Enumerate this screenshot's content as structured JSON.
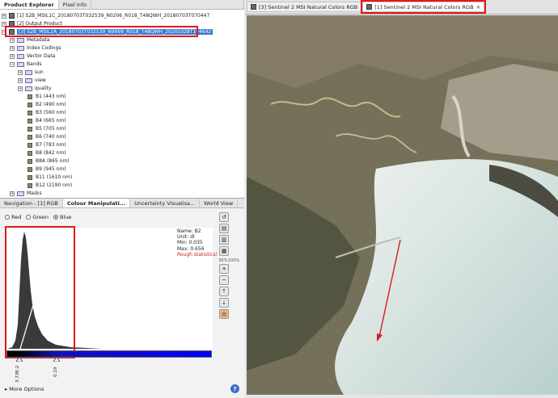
{
  "left_tabs": [
    "Product Explorer",
    "Pixel Info"
  ],
  "tree": {
    "product1": "[1] S2B_MSIL1C_20180703T032539_N0206_R018_T48QWH_20180703T070447",
    "output_product": "[2] Output Product",
    "product3": "[3] S2B_MSIL2A_20180703T032539_N9999_R018_T48QWH_20201028T194642",
    "metadata": "Metadata",
    "index_codings": "Index Codings",
    "vector_data": "Vector Data",
    "bands": "Bands",
    "folders": [
      "sun",
      "view",
      "quality"
    ],
    "band_items": [
      "B1 (443 nm)",
      "B2 (490 nm)",
      "B3 (560 nm)",
      "B4 (665 nm)",
      "B5 (705 nm)",
      "B6 (740 nm)",
      "B7 (783 nm)",
      "B8 (842 nm)",
      "B8A (865 nm)",
      "B9 (945 nm)",
      "B11 (1610 nm)",
      "B12 (2190 nm)"
    ],
    "masks": "Masks"
  },
  "nav_tabs": [
    "Navigation - [1] RGB",
    "Colour Manipulati...",
    "Uncertainty Visualisa...",
    "World View"
  ],
  "radio": {
    "red": "Red",
    "green": "Green",
    "blue": "Blue",
    "selected": "Blue"
  },
  "stats": {
    "name": "Name: B2",
    "unit": "Unit: dl",
    "min": "Min: 0.035",
    "max": "Max: 0.656",
    "warning": "Rough statistics!"
  },
  "slider_values": {
    "low": "3.73E-2",
    "high": "0.19"
  },
  "tool_labels": {
    "p95": "95%",
    "p100": "100%"
  },
  "more_options": "More Options",
  "help": "?",
  "image_tabs": [
    "[3] Sentinel 2 MSI Natural Colors RGB",
    "[1] Sentinel 2 MSI Natural Colors RGB"
  ],
  "colors": {
    "highlight": "#e0191b",
    "selection": "#3a78d6",
    "blue_bar": "#0000ff"
  }
}
